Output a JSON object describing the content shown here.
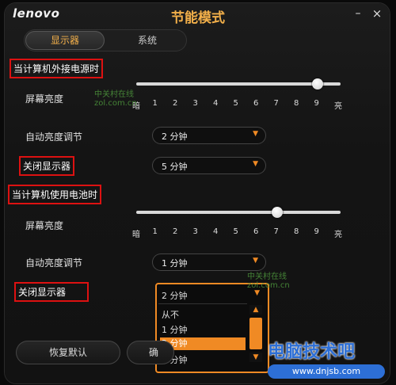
{
  "app": {
    "brand": "lenovo",
    "title": "节能模式"
  },
  "window": {
    "minimize_symbol": "–",
    "close_symbol": "×"
  },
  "tabs": [
    {
      "label": "显示器",
      "active": true
    },
    {
      "label": "系统",
      "active": false
    }
  ],
  "ac_section": {
    "header": "当计算机外接电源时",
    "brightness_label": "屏幕亮度",
    "brightness_level": 9,
    "auto_brightness_label": "自动亮度调节",
    "auto_brightness_value": "2 分钟",
    "turn_off_label": "关闭显示器",
    "turn_off_value": "5 分钟"
  },
  "battery_section": {
    "header": "当计算机使用电池时",
    "brightness_label": "屏幕亮度",
    "brightness_level": 7,
    "auto_brightness_label": "自动亮度调节",
    "auto_brightness_value": "1 分钟",
    "turn_off_label": "关闭显示器",
    "turn_off_value": "2 分钟"
  },
  "scale_ticks": [
    "暗",
    "1",
    "2",
    "3",
    "4",
    "5",
    "6",
    "7",
    "8",
    "9",
    "亮"
  ],
  "dropdown_options": [
    "从不",
    "1 分钟",
    "2 分钟",
    "3 分钟"
  ],
  "dropdown_selected": "2 分钟",
  "footer": {
    "restore_label": "恢复默认",
    "partial_label": "确"
  },
  "watermarks": {
    "site_name": "中关村在线",
    "site_domain": "zol.com.cn",
    "big": "电脑技术吧",
    "small": "www.dnjsb.com"
  },
  "colors": {
    "accent_orange": "#f08a24",
    "title_orange": "#f3b04a",
    "highlight_red": "#dd1111"
  }
}
